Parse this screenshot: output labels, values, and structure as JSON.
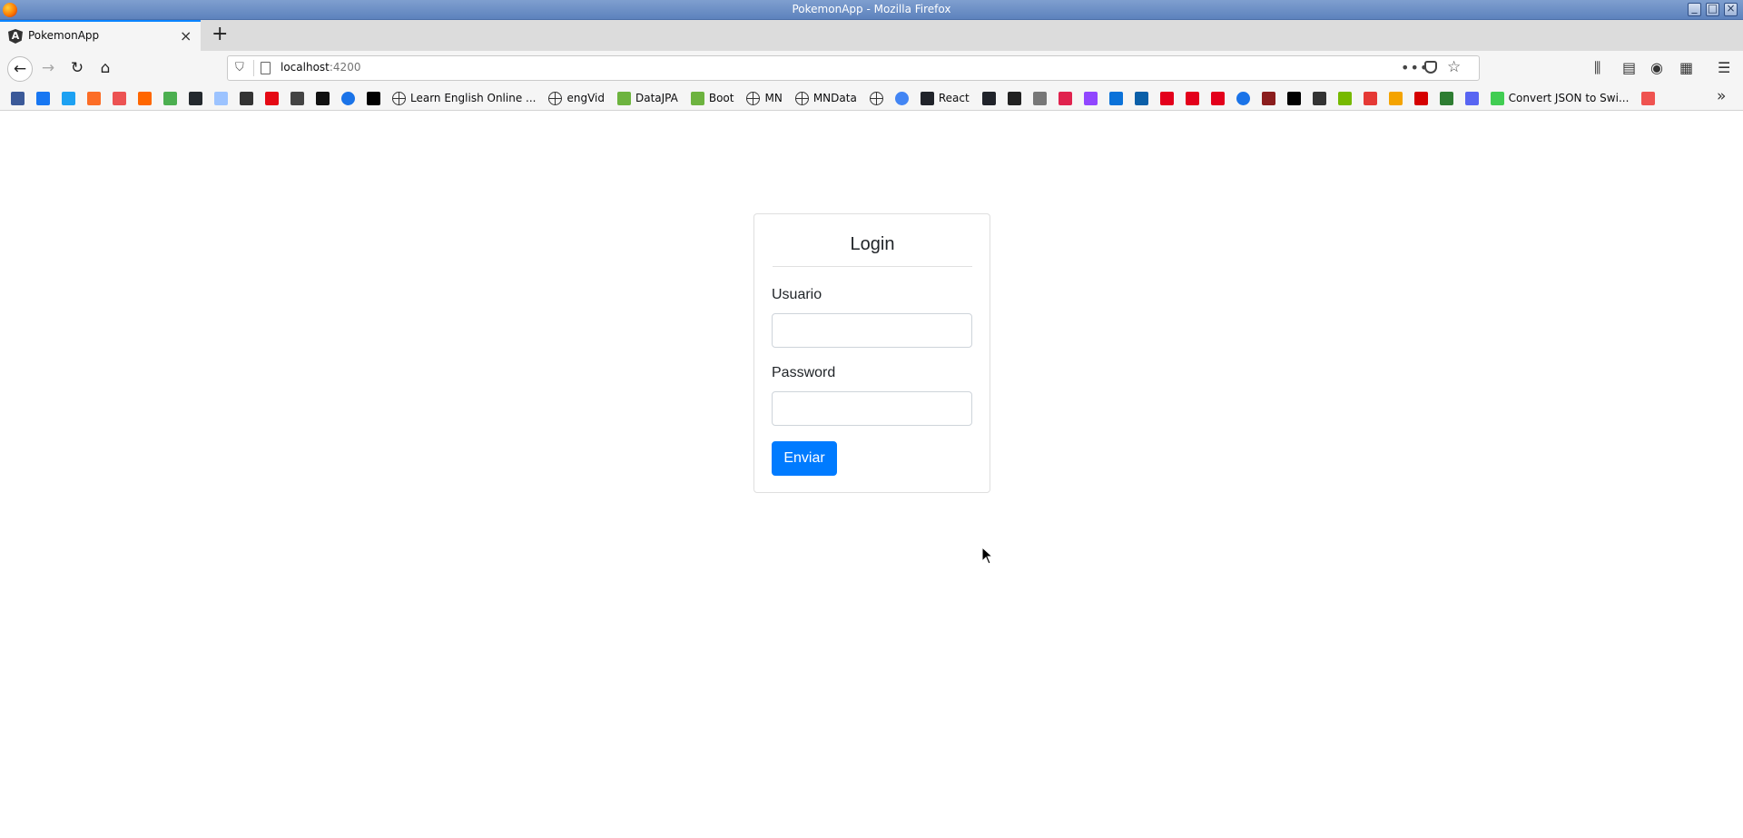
{
  "window": {
    "title": "PokemonApp - Mozilla Firefox"
  },
  "tabs": [
    {
      "title": "PokemonApp",
      "favicon": "angular-icon",
      "active": true
    }
  ],
  "navbar": {
    "url_host": "localhost",
    "url_port": ":4200"
  },
  "bookmarks": [
    {
      "icon": "bm-icon",
      "label": "",
      "color": "#3b5998"
    },
    {
      "icon": "facebook-icon",
      "label": "",
      "color": "#1877f2"
    },
    {
      "icon": "twitter-icon",
      "label": "",
      "color": "#1da1f2"
    },
    {
      "icon": "gitlab-icon",
      "label": "",
      "color": "#fc6d26"
    },
    {
      "icon": "udemy-icon",
      "label": "",
      "color": "#ec5252"
    },
    {
      "icon": "ycombinator-icon",
      "label": "",
      "color": "#ff6600"
    },
    {
      "icon": "bird-icon",
      "label": "",
      "color": "#4caf50"
    },
    {
      "icon": "github-icon",
      "label": "",
      "color": "#24292e"
    },
    {
      "icon": "dev-icon",
      "label": "",
      "color": "#9cc3ff"
    },
    {
      "icon": "library-icon",
      "label": "",
      "color": "#333333"
    },
    {
      "icon": "netflix-icon",
      "label": "",
      "color": "#e50914"
    },
    {
      "icon": "page-icon",
      "label": "",
      "color": "#444444"
    },
    {
      "icon": "hbo-icon",
      "label": "",
      "color": "#111111"
    },
    {
      "icon": "play-icon",
      "label": "",
      "color": "#1a73e8"
    },
    {
      "icon": "notion-icon",
      "label": "",
      "color": "#000000"
    },
    {
      "icon": "globe-icon",
      "label": "Learn English Online ...",
      "color": "#333333"
    },
    {
      "icon": "globe-icon",
      "label": "engVid",
      "color": "#333333"
    },
    {
      "icon": "spring-icon",
      "label": "DataJPA",
      "color": "#6db33f"
    },
    {
      "icon": "spring-icon",
      "label": "Boot",
      "color": "#6db33f"
    },
    {
      "icon": "globe-icon",
      "label": "MN",
      "color": "#333333"
    },
    {
      "icon": "globe-icon",
      "label": "MNData",
      "color": "#333333"
    },
    {
      "icon": "globe-icon",
      "label": "",
      "color": "#333333"
    },
    {
      "icon": "circle-icon",
      "label": "",
      "color": "#4285f4"
    },
    {
      "icon": "react-icon",
      "label": "React",
      "color": "#20232a"
    },
    {
      "icon": "react-dark-icon",
      "label": "",
      "color": "#20232a"
    },
    {
      "icon": "lambda-icon",
      "label": "",
      "color": "#222222"
    },
    {
      "icon": "ghost-icon",
      "label": "",
      "color": "#777777"
    },
    {
      "icon": "nest-icon",
      "label": "",
      "color": "#e0234e"
    },
    {
      "icon": "twitch-icon",
      "label": "",
      "color": "#9146ff"
    },
    {
      "icon": "ij-icon",
      "label": "",
      "color": "#0b72d9"
    },
    {
      "icon": "wave-icon",
      "label": "",
      "color": "#0a5fa8"
    },
    {
      "icon": "oracle-icon",
      "label": "",
      "color": "#e3001b"
    },
    {
      "icon": "oracle-icon",
      "label": "",
      "color": "#e3001b"
    },
    {
      "icon": "oracle-icon",
      "label": "",
      "color": "#e3001b"
    },
    {
      "icon": "at-icon",
      "label": "",
      "color": "#1a73e8"
    },
    {
      "icon": "shield-crest-icon",
      "label": "",
      "color": "#8b1d1d"
    },
    {
      "icon": "a-icon",
      "label": "",
      "color": "#000000"
    },
    {
      "icon": "book-icon",
      "label": "",
      "color": "#333333"
    },
    {
      "icon": "nvidia-icon",
      "label": "",
      "color": "#76b900"
    },
    {
      "icon": "stack-icon",
      "label": "",
      "color": "#e53935"
    },
    {
      "icon": "code-icon",
      "label": "",
      "color": "#f4a300"
    },
    {
      "icon": "v-icon",
      "label": "",
      "color": "#d50000"
    },
    {
      "icon": "tree-icon",
      "label": "",
      "color": "#2e7d32"
    },
    {
      "icon": "discord-icon",
      "label": "",
      "color": "#5865f2"
    },
    {
      "icon": "qt-icon",
      "label": "Convert JSON to Swi...",
      "color": "#41cd52"
    },
    {
      "icon": "calendar-icon",
      "label": "",
      "color": "#ef5350"
    }
  ],
  "login": {
    "title": "Login",
    "user_label": "Usuario",
    "user_value": "",
    "password_label": "Password",
    "password_value": "",
    "submit_label": "Enviar",
    "accent": "#007bff"
  }
}
